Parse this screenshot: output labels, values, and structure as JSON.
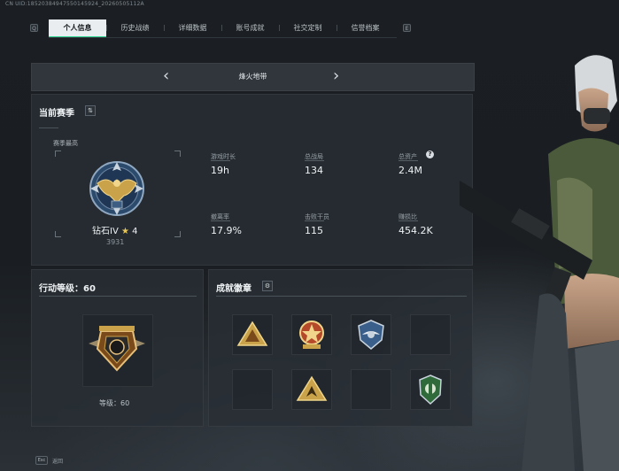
{
  "window": {
    "uid_text": "CN UID:18520384947550145924_20260505112A"
  },
  "tabs": [
    {
      "label": "个人信息",
      "active": true
    },
    {
      "label": "历史战绩",
      "active": false
    },
    {
      "label": "详细数据",
      "active": false
    },
    {
      "label": "账号成就",
      "active": false
    },
    {
      "label": "社交定制",
      "active": false
    },
    {
      "label": "信誉档案",
      "active": false
    }
  ],
  "tab_keys": {
    "left": "Q",
    "right": "E"
  },
  "map_selector": {
    "title": "烽火地带",
    "prev_icon": "chevron-left-icon",
    "next_icon": "chevron-right-icon"
  },
  "season": {
    "title": "当前赛季",
    "toggle_icon": "swap-icon",
    "best_label": "赛季最高",
    "rank_name": "钻石IV",
    "rank_stars": "4",
    "rank_score": "3931"
  },
  "stats": [
    {
      "label": "游戏时长",
      "value": "19h"
    },
    {
      "label": "总战局",
      "value": "134"
    },
    {
      "label": "总资产",
      "value": "2.4M",
      "has_help": true
    },
    {
      "label": "撤离率",
      "value": "17.9%"
    },
    {
      "label": "击败干员",
      "value": "115"
    },
    {
      "label": "赚损比",
      "value": "454.2K"
    }
  ],
  "action_level": {
    "title": "行动等级：",
    "value": "60",
    "level_label": "等级：60"
  },
  "achievements": {
    "title": "成就徽章",
    "settings_icon": "gear-icon",
    "badges": [
      {
        "name": "pyramid-badge",
        "filled": true
      },
      {
        "name": "star-medal-badge",
        "filled": true
      },
      {
        "name": "wing-shield-badge",
        "filled": true
      },
      {
        "name": "empty-slot",
        "filled": false
      },
      {
        "name": "empty-slot",
        "filled": false
      },
      {
        "name": "arrow-triangle-badge",
        "filled": true
      },
      {
        "name": "empty-slot",
        "filled": false
      },
      {
        "name": "green-shield-badge",
        "filled": true
      }
    ]
  },
  "footer": {
    "key": "Esc",
    "label": "返回"
  },
  "colors": {
    "accent": "#2bd48f",
    "panel": "#282e34",
    "gold": "#c9a24a"
  }
}
